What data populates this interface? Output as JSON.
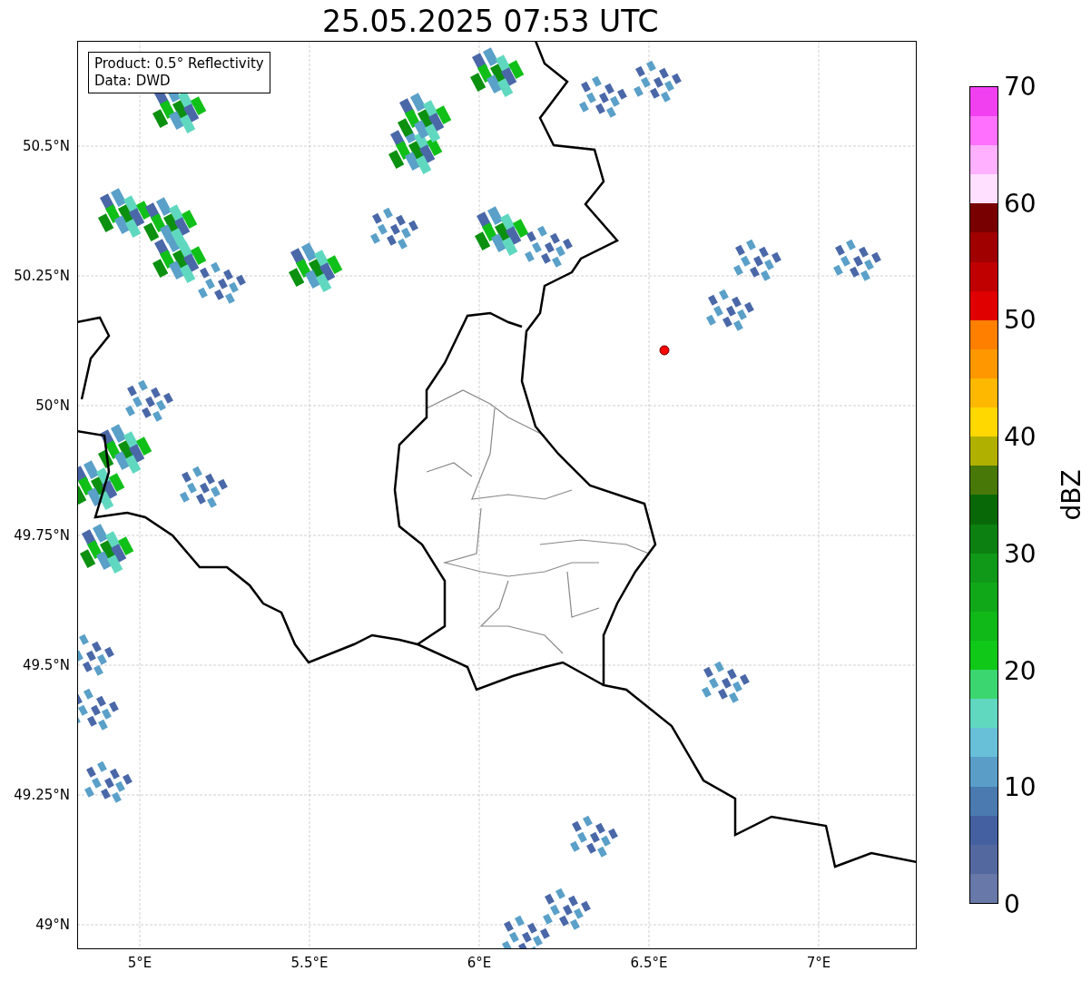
{
  "title": "25.05.2025 07:53 UTC",
  "map": {
    "legend": [
      "Product: 0.5° Reflectivity",
      "Data: DWD"
    ],
    "yticks": [
      "50.5°N",
      "50.25°N",
      "50°N",
      "49.75°N",
      "49.5°N",
      "49.25°N",
      "49°N"
    ],
    "xticks": [
      "5°E",
      "5.5°E",
      "6°E",
      "6.5°E",
      "7°E"
    ]
  },
  "colorbar": {
    "label": "dBZ",
    "ticks": [
      "70",
      "60",
      "50",
      "40",
      "30",
      "20",
      "10",
      "0"
    ],
    "bands": [
      {
        "color": "#6878a8"
      },
      {
        "color": "#5468a0"
      },
      {
        "color": "#4460a0"
      },
      {
        "color": "#4a7ab0"
      },
      {
        "color": "#5a9ec8"
      },
      {
        "color": "#68c0d8"
      },
      {
        "color": "#60d8c0"
      },
      {
        "color": "#3cd670"
      },
      {
        "color": "#10c818"
      },
      {
        "color": "#10b818"
      },
      {
        "color": "#10a818"
      },
      {
        "color": "#109818"
      },
      {
        "color": "#0c8010"
      },
      {
        "color": "#086808"
      },
      {
        "color": "#487808"
      },
      {
        "color": "#b0b000"
      },
      {
        "color": "#ffd800"
      },
      {
        "color": "#ffb800"
      },
      {
        "color": "#ff9800"
      },
      {
        "color": "#ff8000"
      },
      {
        "color": "#e00000"
      },
      {
        "color": "#c00000"
      },
      {
        "color": "#a00000"
      },
      {
        "color": "#780000"
      },
      {
        "color": "#ffe0ff"
      },
      {
        "color": "#ffb0ff"
      },
      {
        "color": "#ff70ff"
      },
      {
        "color": "#f040f0"
      }
    ]
  }
}
